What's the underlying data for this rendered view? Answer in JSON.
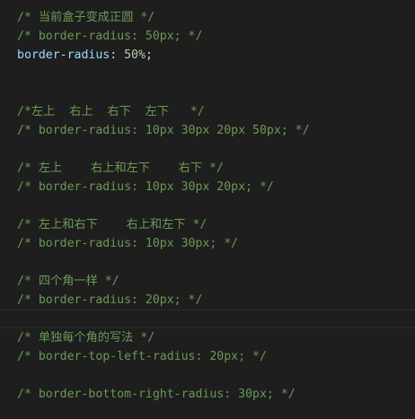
{
  "editor": {
    "lines": [
      {
        "type": "comment",
        "text": "/* 当前盒子变成正圆 */"
      },
      {
        "type": "comment",
        "text": "/* border-radius: 50px; */"
      },
      {
        "type": "decl",
        "prop": "border-radius",
        "colon": ": ",
        "value": "50%",
        "semi": ";"
      },
      {
        "type": "blank",
        "text": ""
      },
      {
        "type": "blank",
        "text": ""
      },
      {
        "type": "comment",
        "text": "/*左上  右上  右下  左下   */"
      },
      {
        "type": "comment",
        "text": "/* border-radius: 10px 30px 20px 50px; */"
      },
      {
        "type": "blank",
        "text": ""
      },
      {
        "type": "comment",
        "text": "/* 左上    右上和左下    右下 */"
      },
      {
        "type": "comment",
        "text": "/* border-radius: 10px 30px 20px; */"
      },
      {
        "type": "blank",
        "text": ""
      },
      {
        "type": "comment",
        "text": "/* 左上和右下    右上和左下 */"
      },
      {
        "type": "comment",
        "text": "/* border-radius: 10px 30px; */"
      },
      {
        "type": "blank",
        "text": ""
      },
      {
        "type": "comment",
        "text": "/* 四个角一样 */"
      },
      {
        "type": "comment",
        "text": "/* border-radius: 20px; */"
      },
      {
        "type": "blank",
        "text": "",
        "current": true
      },
      {
        "type": "comment",
        "text": "/* 单独每个角的写法 */"
      },
      {
        "type": "comment",
        "text": "/* border-top-left-radius: 20px; */"
      },
      {
        "type": "blank",
        "text": ""
      },
      {
        "type": "comment",
        "text": "/* border-bottom-right-radius: 30px; */"
      }
    ]
  }
}
